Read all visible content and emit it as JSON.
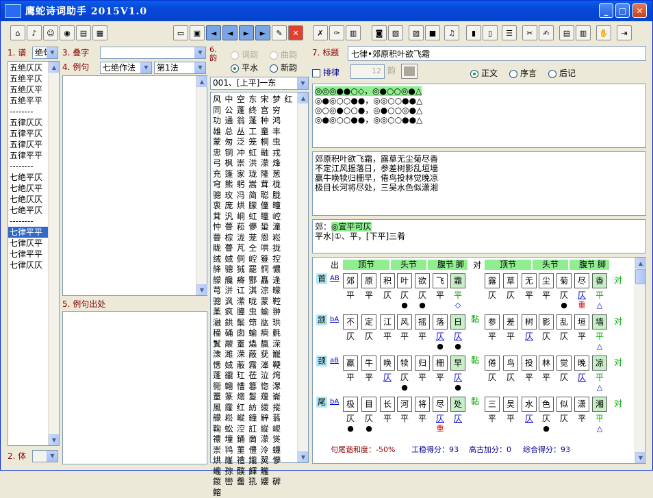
{
  "app": {
    "title": "鹰蛇诗词助手 2015V1.0"
  },
  "window_buttons": {
    "min": "_",
    "max": "□",
    "close": "✕"
  },
  "left": {
    "pu_label": "1. 谱",
    "pu_value": "绝句",
    "ti_label": "2. 体",
    "list": [
      "五绝仄仄",
      "五绝平仄",
      "五绝仄平",
      "五绝平平",
      "--------",
      "五律仄仄",
      "五律平仄",
      "五律仄平",
      "五律平平",
      "--------",
      "七绝平仄",
      "七绝仄平",
      "七绝仄仄",
      "七绝平仄",
      "--------",
      "七律平平",
      "七律仄平",
      "七律平平",
      "七律仄仄"
    ],
    "selected_index": 15
  },
  "mid": {
    "diezi_label": "3. 叠字",
    "liju_label": "4. 例句",
    "liju_sel1": "七绝作法",
    "liju_sel2": "第1法",
    "chuchu_label": "5. 例句出处"
  },
  "rhyme": {
    "label": "6. 韵",
    "opt_shiyun": "词韵",
    "opt_quyun": "曲韵",
    "opt_pingshui": "平水",
    "opt_xinyun": "新韵",
    "selected": "平水",
    "dropdown": "001、[上平]一东",
    "rows": [
      "风中空东宋梦红",
      "同公蓬终宫穷",
      "功通翁蓬种鸿",
      "雄总丛工童丰",
      "蒙匆泛笼桐虫",
      "忠铜冲虹融戎",
      "弓枫崇洪濛烽",
      "充篷家珑隆葱",
      "穹熊躬嵩茸栊",
      "骢玫冯简聪胧",
      "衷庞烘朦僮疃",
      "茸汎峒虹瞳崆",
      "忡瞢菘儚蛩潼",
      "瞢棕泷茏恩崧",
      "眬瞢芃仝哄拢",
      "绒娀侗崆簦控",
      "舽骢狨罷恫憹",
      "艨艬瘠酆矗逢",
      "芎洴讧淇淙曚",
      "骢沨潆咙蒙鞚",
      "葇疯朣虫蝓翀",
      "瀜鉷鬃筇谹珙",
      "穜硧囱蝓痌氃",
      "鬒鬷罿爞靝溁",
      "潨潍溁蔽莸巃",
      "憽娀蔽霿溄鞕",
      "蓬豅玒莅泣焪",
      "衕翺慒篡惚潈",
      "罿篆熜鬉蕿崙",
      "風霳红紡緵摐",
      "艨崧嵷鐘觪蓊",
      "鞠蚣涳訌縱嵕",
      "禯墥銿啇濛熧",
      "崇鸨菫僼泠蠛",
      "烘嶐禮鑨翜懜",
      "巄孮醭餫贚",
      "鍐巒齹犼孆硸",
      "鰫"
    ]
  },
  "right": {
    "title_label": "7. 标题",
    "title_value": "七律•郊原积叶欲飞霜",
    "pailu_label": "排律",
    "yun_label": "韵",
    "yun_value": "12",
    "opt_zhengwen": "正文",
    "opt_xuyan": "序言",
    "opt_houji": "后记",
    "tonal": [
      "◎◎◎●●○◇，◎●○○◎●△",
      "◎●◎○○●●，◎◎○○●●△",
      "◎○◎●○○●，◎●○○◎●△",
      "◎●◎○○●●，◎◎○○●●△"
    ],
    "poem": [
      "郊原积叶欲飞霜，露草无尘菊尽香",
      "不定江风摇落日，参差树影乱垣墙",
      "赢牛唤犊归栅早，倦鸟投林觉晚凉",
      "极目长河将尽处，三吴水色似潇湘"
    ],
    "note_prefix": "郊：",
    "note_hl": "◎宜平可仄",
    "note_line2": "平水|①、平，[下平]三肴"
  },
  "analysis": {
    "chu_label": "出",
    "dui_label": "对",
    "headers": [
      "顶节",
      "头节",
      "腹节",
      "脚"
    ],
    "rows": [
      {
        "label": "首",
        "ab": "AB",
        "chu": [
          "郊",
          "原",
          "积",
          "叶",
          "欲",
          "飞",
          "霜"
        ],
        "chu_t": [
          "平",
          "平",
          "仄",
          "仄",
          "仄",
          "平",
          "平"
        ],
        "chu_m": [
          "",
          "",
          "",
          "●",
          "●",
          "",
          "◇"
        ],
        "zhan": "",
        "dui": [
          "露",
          "草",
          "无",
          "尘",
          "菊",
          "尽",
          "香"
        ],
        "dui_t": [
          "仄",
          "仄",
          "平",
          "平",
          "仄",
          "仄",
          "平"
        ],
        "dui_m": [
          "",
          "",
          "",
          "",
          "●",
          "重",
          "△"
        ],
        "end": "对"
      },
      {
        "label": "颔",
        "ab": "bA",
        "chu": [
          "不",
          "定",
          "江",
          "风",
          "摇",
          "落",
          "日"
        ],
        "chu_t": [
          "仄",
          "仄",
          "平",
          "平",
          "平",
          "仄",
          "仄"
        ],
        "chu_m": [
          "",
          "",
          "",
          "",
          "",
          "●",
          "●"
        ],
        "zhan": "黏",
        "dui": [
          "参",
          "差",
          "树",
          "影",
          "乱",
          "垣",
          "墙"
        ],
        "dui_t": [
          "平",
          "平",
          "仄",
          "仄",
          "仄",
          "平",
          "平"
        ],
        "dui_m": [
          "",
          "",
          "",
          "",
          "",
          "",
          "△"
        ],
        "end": "对"
      },
      {
        "label": "颈",
        "ab": "aB",
        "chu": [
          "赢",
          "牛",
          "唤",
          "犊",
          "归",
          "栅",
          "早"
        ],
        "chu_t": [
          "平",
          "平",
          "仄",
          "仄",
          "平",
          "平",
          "仄"
        ],
        "chu_m": [
          "",
          "",
          "",
          "●",
          "",
          "",
          "●"
        ],
        "zhan": "黏",
        "dui": [
          "倦",
          "鸟",
          "投",
          "林",
          "觉",
          "晚",
          "凉"
        ],
        "dui_t": [
          "仄",
          "仄",
          "平",
          "平",
          "仄",
          "仄",
          "平"
        ],
        "dui_m": [
          "",
          "",
          "",
          "",
          "",
          "",
          "△"
        ],
        "end": "对"
      },
      {
        "label": "尾",
        "ab": "bA",
        "chu": [
          "极",
          "目",
          "长",
          "河",
          "将",
          "尽",
          "处"
        ],
        "chu_t": [
          "仄",
          "仄",
          "平",
          "平",
          "平",
          "仄",
          "仄"
        ],
        "chu_m": [
          "●",
          "●",
          "",
          "",
          "",
          "重",
          ""
        ],
        "zhan": "黏",
        "dui": [
          "三",
          "吴",
          "水",
          "色",
          "似",
          "潇",
          "湘"
        ],
        "dui_t": [
          "平",
          "平",
          "仄",
          "仄",
          "仄",
          "平",
          "平"
        ],
        "dui_m": [
          "",
          "",
          "",
          "●",
          "",
          "",
          "△"
        ],
        "end": "对"
      }
    ],
    "stat_harmony": "句尾谐和度：-50%",
    "stat_gong": "工稳得分：93",
    "stat_gaogu": "高古加分：0",
    "stat_total": "综合得分：93"
  },
  "colors": {
    "title_bar": "#0648d8",
    "selection": "#316ac5",
    "highlight": "#90ee90"
  },
  "toolbar_icons": [
    "home-icon",
    "music-icon",
    "penguin-icon",
    "globe-icon",
    "book-icon",
    "color-grid-icon",
    "document-icon",
    "save-icon",
    "first-arrow-icon",
    "prev-arrow-icon",
    "next-arrow-icon",
    "last-arrow-icon",
    "edit-icon",
    "close-icon",
    "erase-icon",
    "brush-icon",
    "books-icon",
    "camera-icon",
    "image-icon",
    "note-icon",
    "box-icon",
    "pen-icon",
    "chart-icon",
    "chart2-icon",
    "list-icon",
    "tools-icon",
    "notes-icon",
    "book2-icon",
    "books2-icon",
    "hand-icon",
    "exit-icon"
  ]
}
